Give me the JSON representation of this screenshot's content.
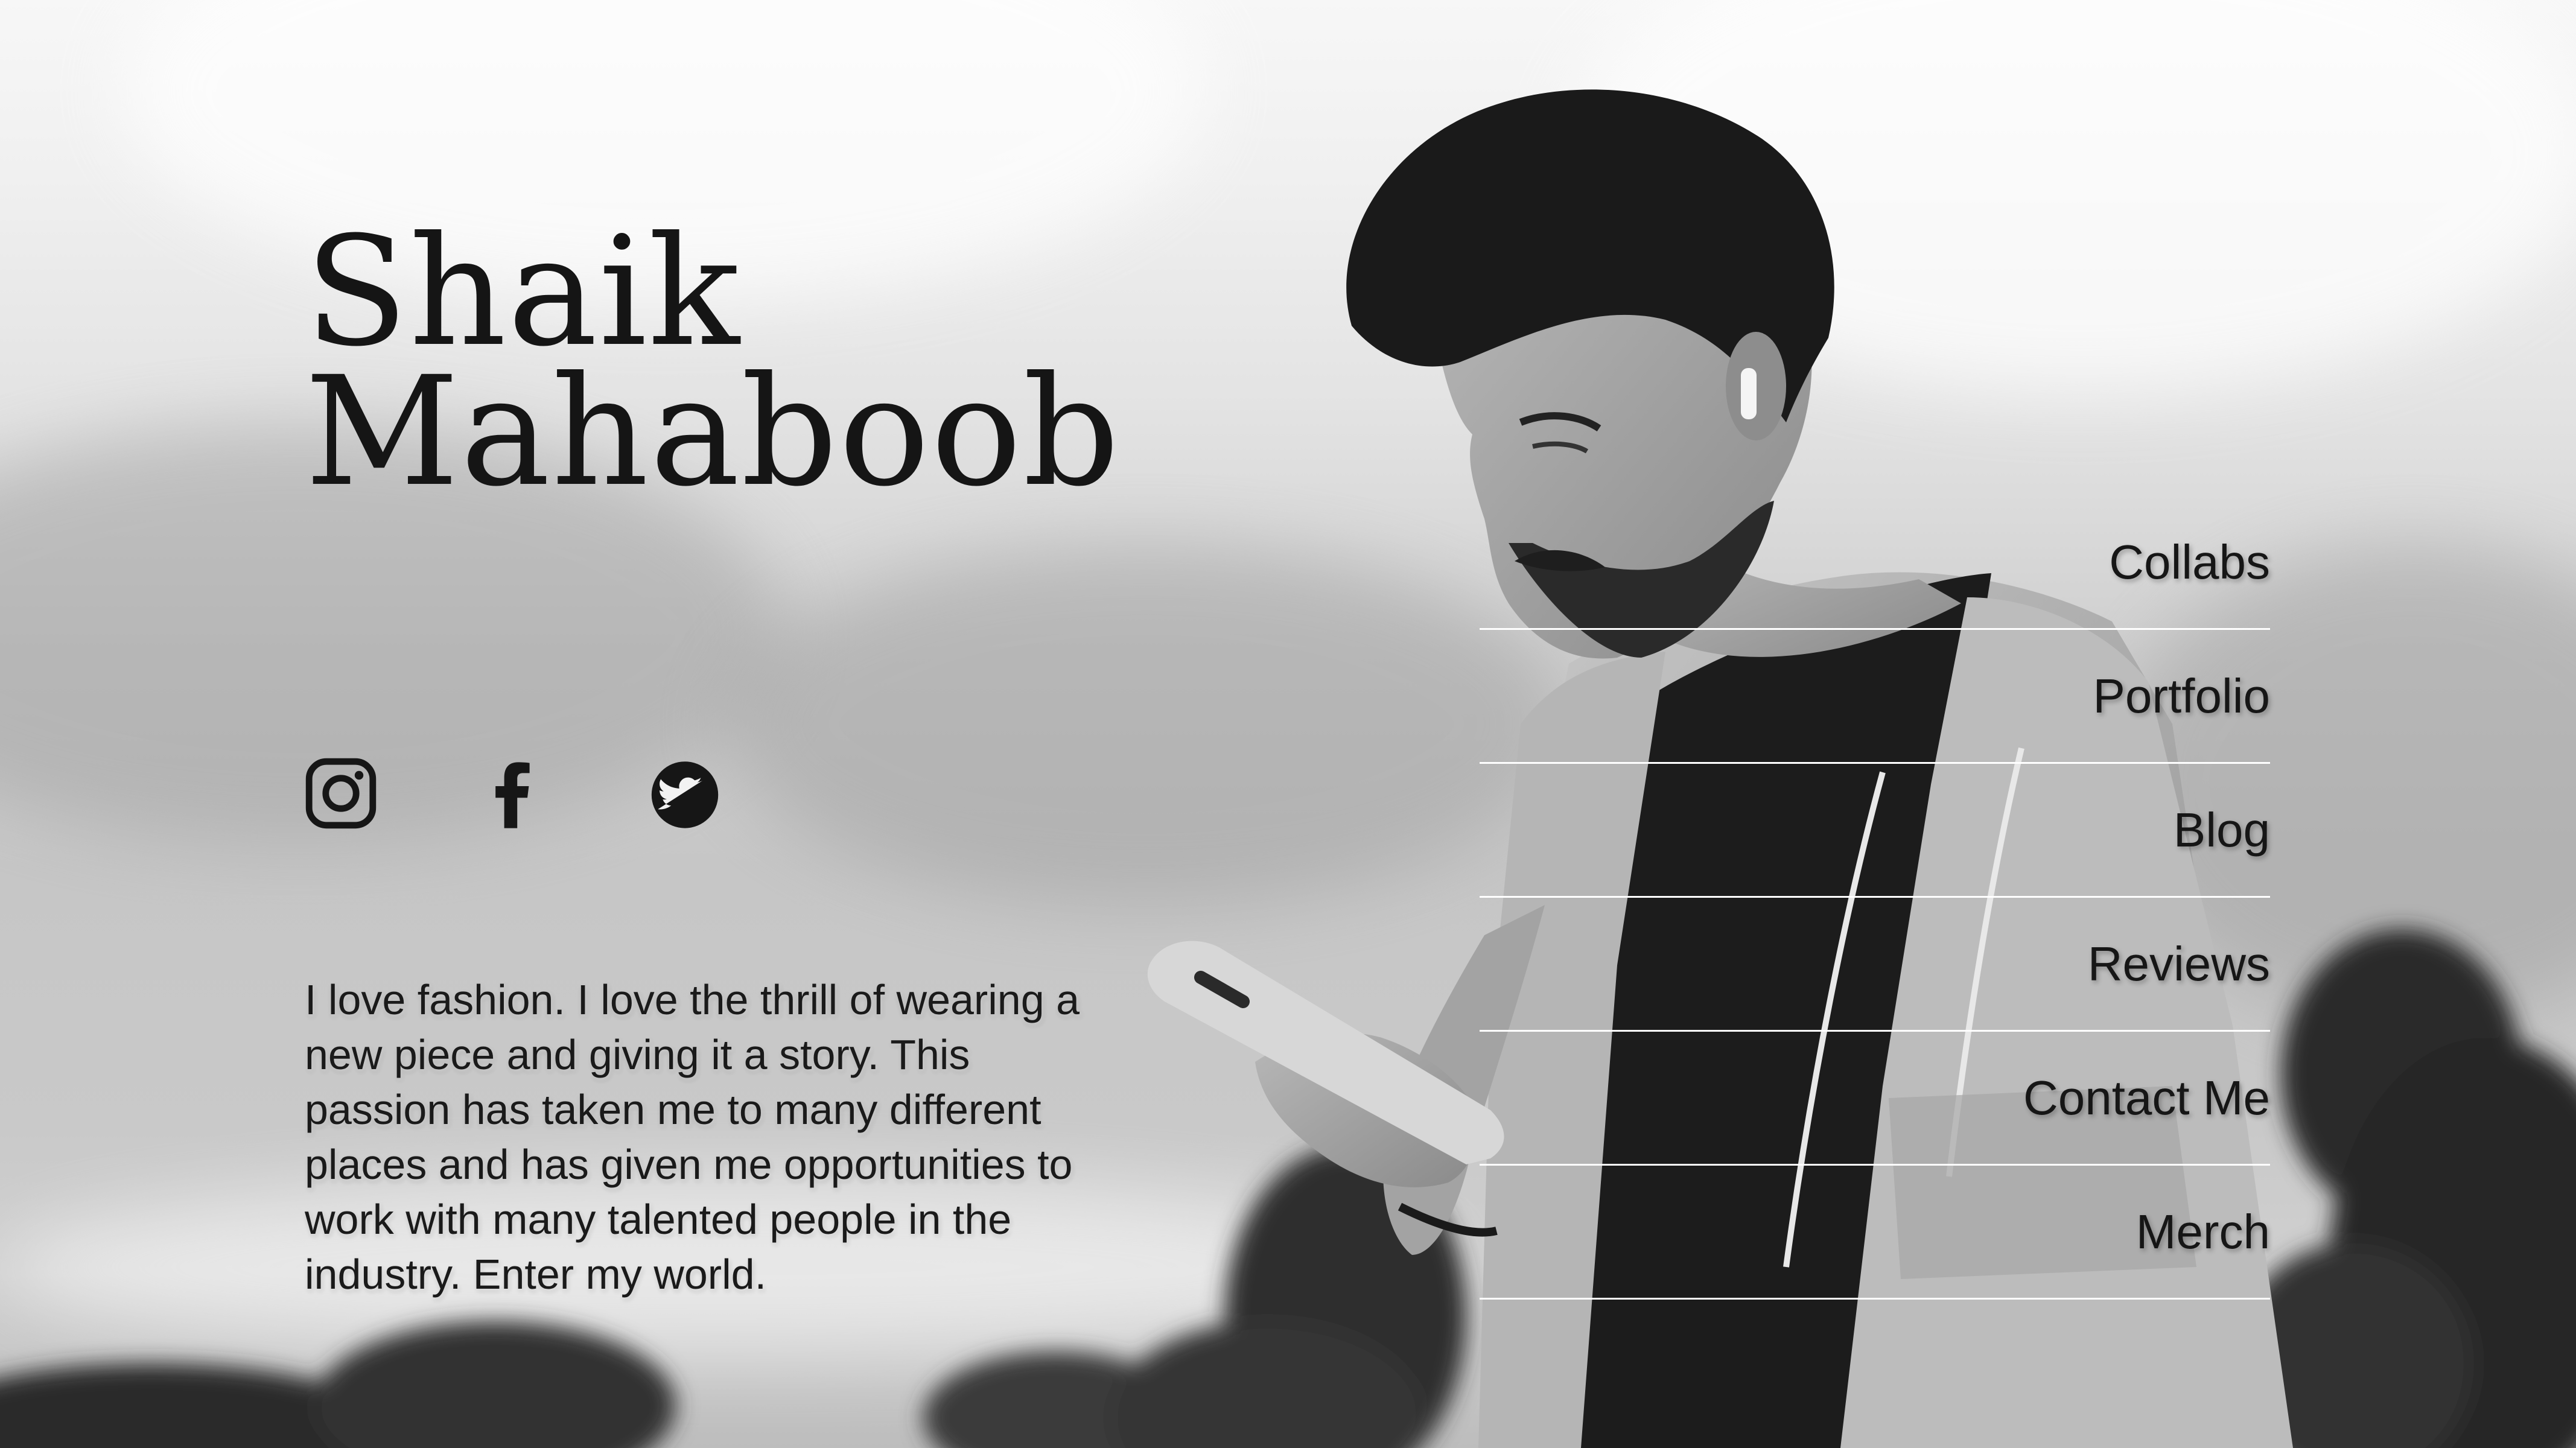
{
  "profile": {
    "name_line1": "Shaik",
    "name_line2": "Mahaboob",
    "bio": "I love fashion. I love the thrill of wearing a new piece and giving it a story. This passion has taken me to many different places and has given me opportunities to work with many talented people in the industry. Enter my world."
  },
  "socials": [
    {
      "icon": "instagram-icon"
    },
    {
      "icon": "facebook-icon"
    },
    {
      "icon": "twitter-icon"
    }
  ],
  "nav": {
    "items": [
      {
        "label": "Collabs"
      },
      {
        "label": "Portfolio"
      },
      {
        "label": "Blog"
      },
      {
        "label": "Reviews"
      },
      {
        "label": "Contact Me"
      },
      {
        "label": "Merch"
      }
    ]
  },
  "colors": {
    "text": "#151515",
    "divider": "#ffffff"
  }
}
